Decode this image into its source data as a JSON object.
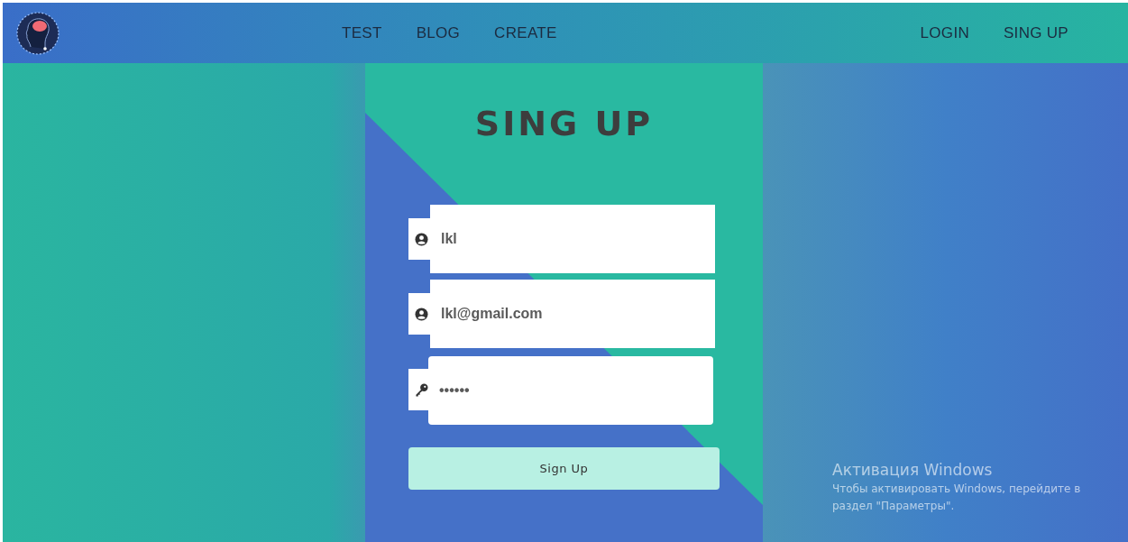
{
  "navbar": {
    "links": [
      {
        "label": "TEST"
      },
      {
        "label": "BLOG"
      },
      {
        "label": "CREATE"
      }
    ],
    "auth_links": [
      {
        "label": "LOGIN"
      },
      {
        "label": "SING UP"
      }
    ]
  },
  "form": {
    "title": "SING UP",
    "fields": [
      {
        "kind": "user",
        "value": "lkl"
      },
      {
        "kind": "user",
        "value": "lkl@gmail.com"
      },
      {
        "kind": "key",
        "value": "••••••"
      }
    ],
    "button": "Sign Up"
  },
  "os_notice": {
    "title": "Активация Windows",
    "text": "Чтобы активировать Windows, перейдите в раздел \"Параметры\"."
  }
}
